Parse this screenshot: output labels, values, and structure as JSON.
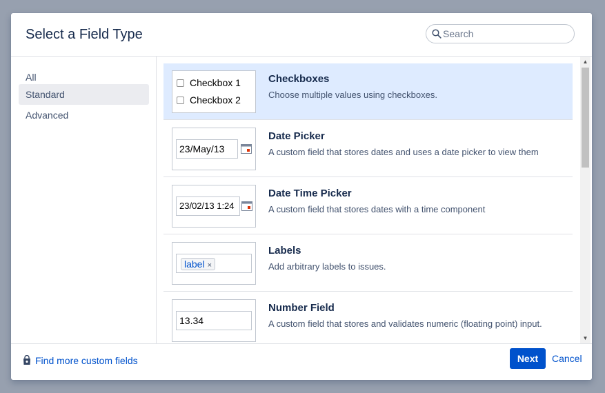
{
  "dialog": {
    "title": "Select a Field Type",
    "search": {
      "placeholder": "Search",
      "value": ""
    }
  },
  "sidebar": {
    "items": [
      {
        "label": "All",
        "active": false
      },
      {
        "label": "Standard",
        "active": true
      },
      {
        "label": "Advanced",
        "active": false
      }
    ]
  },
  "field_types": [
    {
      "title": "Checkboxes",
      "description": "Choose multiple values using checkboxes.",
      "selected": true,
      "preview": {
        "checkbox_1": "Checkbox 1",
        "checkbox_2": "Checkbox 2"
      }
    },
    {
      "title": "Date Picker",
      "description": "A custom field that stores dates and uses a date picker to view them",
      "selected": false,
      "preview": {
        "value": "23/May/13"
      }
    },
    {
      "title": "Date Time Picker",
      "description": "A custom field that stores dates with a time component",
      "selected": false,
      "preview": {
        "value": "23/02/13 1:24"
      }
    },
    {
      "title": "Labels",
      "description": "Add arbitrary labels to issues.",
      "selected": false,
      "preview": {
        "label": "label",
        "remove": "×"
      }
    },
    {
      "title": "Number Field",
      "description": "A custom field that stores and validates numeric (floating point) input.",
      "selected": false,
      "preview": {
        "value": "13.34"
      }
    }
  ],
  "footer": {
    "find_more": "Find more custom fields",
    "next": "Next",
    "cancel": "Cancel"
  },
  "colors": {
    "primary": "#0052cc",
    "selected_row": "#deebff",
    "overlay": "#97a0af"
  }
}
